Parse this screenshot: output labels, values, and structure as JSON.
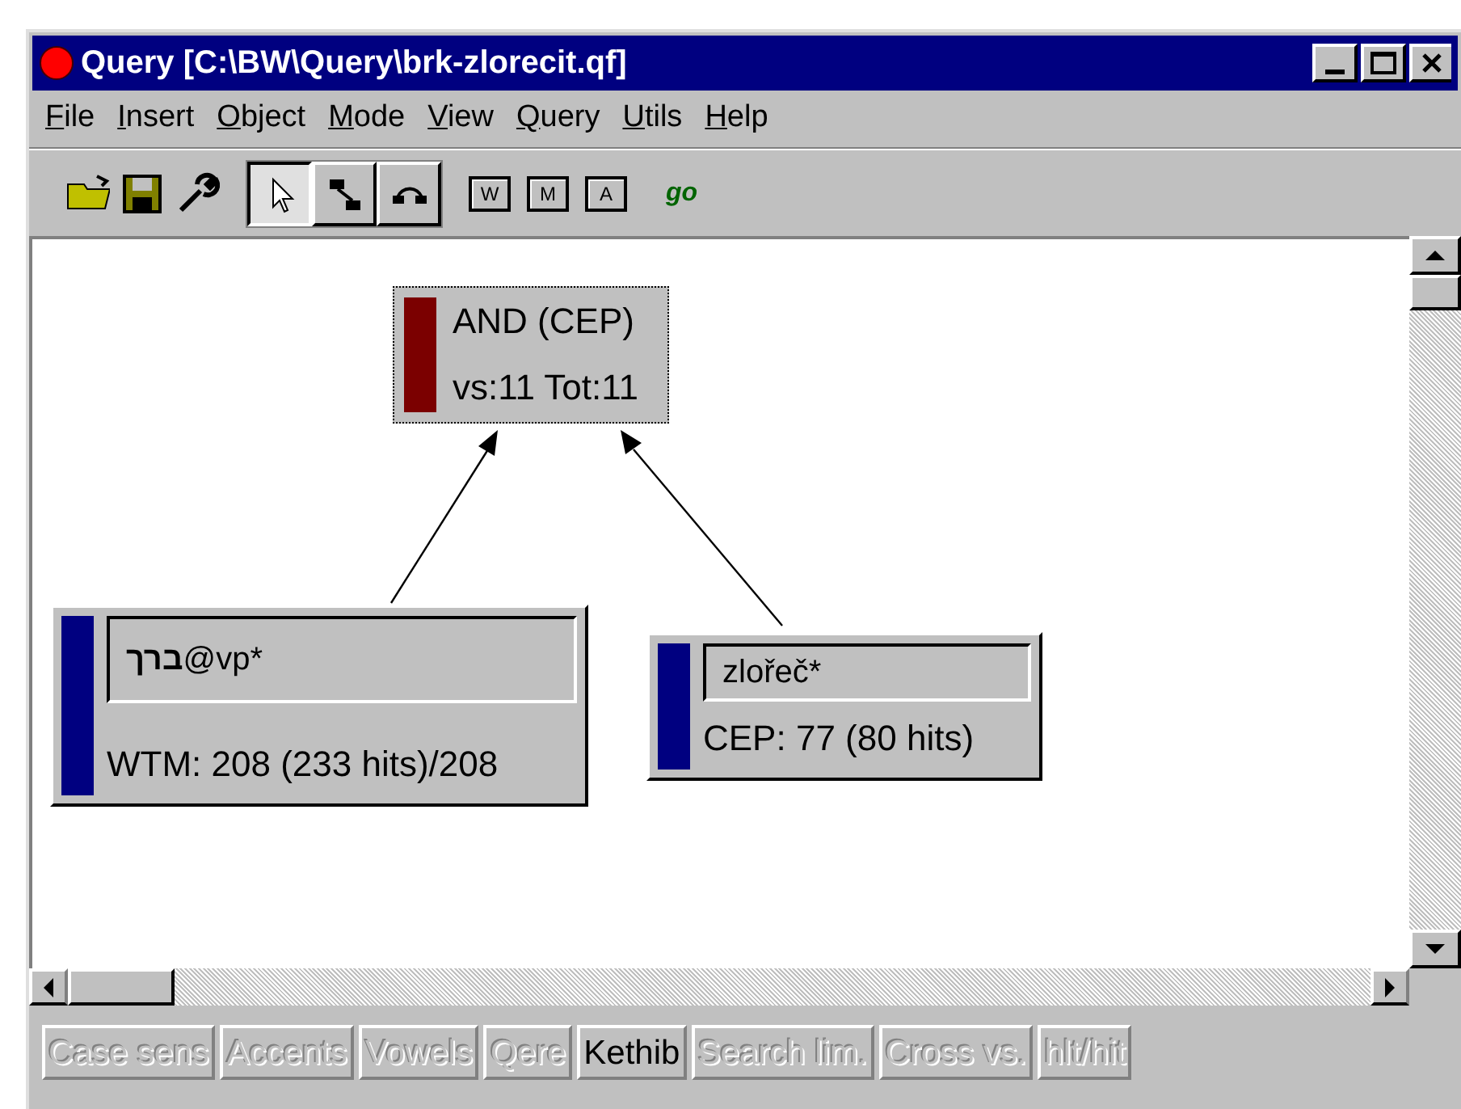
{
  "window": {
    "title": "Query [C:\\BW\\Query\\brk-zlorecit.qf]"
  },
  "menu": [
    "File",
    "Insert",
    "Object",
    "Mode",
    "View",
    "Query",
    "Utils",
    "Help"
  ],
  "toolbar": {
    "files": [
      {
        "kind": "open"
      },
      {
        "kind": "save"
      },
      {
        "kind": "wrench"
      }
    ],
    "modes": [
      {
        "kind": "pointer",
        "selected": true
      },
      {
        "kind": "link",
        "selected": false
      },
      {
        "kind": "arc",
        "selected": false
      }
    ],
    "objects": [
      {
        "label": "W"
      },
      {
        "label": "M"
      },
      {
        "label": "A"
      }
    ],
    "go": "go"
  },
  "diagram": {
    "nodes": [
      {
        "kind": "operator",
        "color": "#7b0000",
        "title": "AND (CEP)",
        "result": "vs:11 Tot:11"
      },
      {
        "kind": "term",
        "color": "#000080",
        "term": "**ברך**@vp*",
        "result": "WTM: 208 (233 hits)/208"
      },
      {
        "kind": "term",
        "color": "#000080",
        "term": "zlořeč*",
        "result": "CEP: 77 (80 hits)"
      }
    ]
  },
  "options": [
    {
      "label": "Case sens",
      "on": false
    },
    {
      "label": "Accents",
      "on": false
    },
    {
      "label": "Vowels",
      "on": false
    },
    {
      "label": "Qere",
      "on": false
    },
    {
      "label": "Kethib",
      "on": true
    },
    {
      "label": "Search lim.",
      "on": false
    },
    {
      "label": "Cross vs.",
      "on": false
    },
    {
      "label": "hlt/hit",
      "on": false
    }
  ]
}
